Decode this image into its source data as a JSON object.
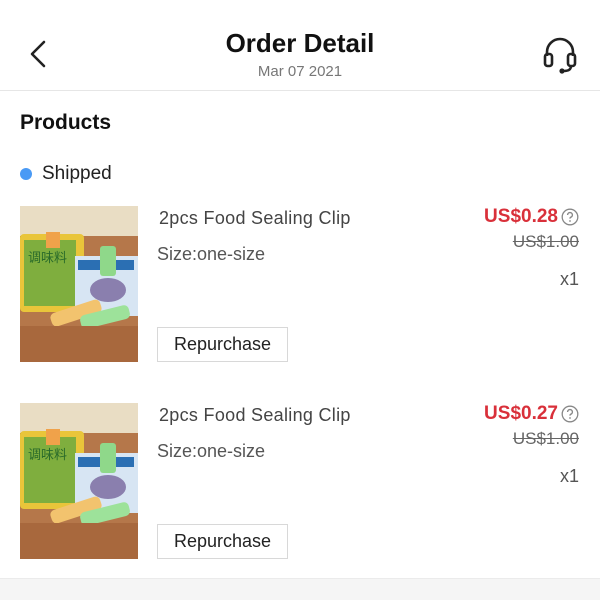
{
  "header": {
    "title": "Order Detail",
    "date": "Mar 07 2021"
  },
  "products_section": {
    "title": "Products",
    "status": "Shipped"
  },
  "items": [
    {
      "name": "2pcs Food Sealing Clip",
      "size": "Size:one-size",
      "price": "US$0.28",
      "original_price": "US$1.00",
      "quantity": "x1",
      "button_label": "Repurchase"
    },
    {
      "name": "2pcs Food Sealing Clip",
      "size": "Size:one-size",
      "price": "US$0.27",
      "original_price": "US$1.00",
      "quantity": "x1",
      "button_label": "Repurchase"
    }
  ],
  "colors": {
    "price": "#d9303a",
    "status_dot": "#4a9af5"
  },
  "icons": {
    "back": "chevron-left-icon",
    "support": "headset-icon",
    "help": "question-circle-icon"
  }
}
